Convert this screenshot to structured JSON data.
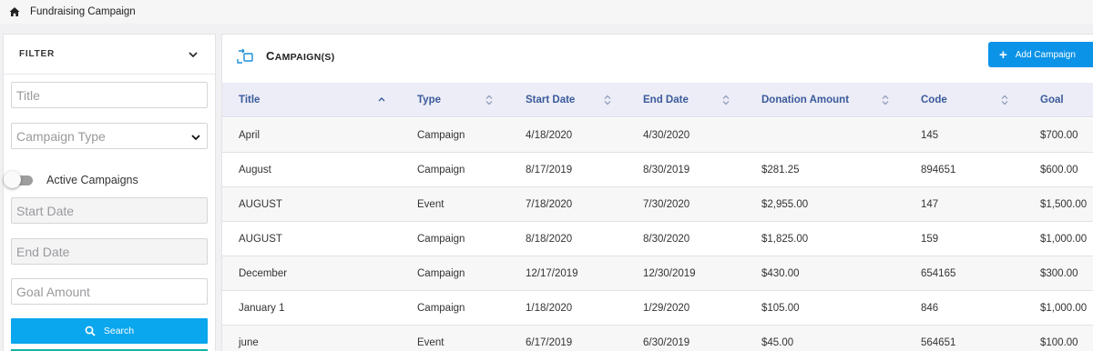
{
  "breadcrumb": {
    "page": "Fundraising Campaign"
  },
  "filter": {
    "header": "FILTER",
    "title_placeholder": "Title",
    "campaign_type_placeholder": "Campaign Type",
    "active_campaigns_label": "Active Campaigns",
    "active_campaigns_on": false,
    "start_date_placeholder": "Start Date",
    "end_date_placeholder": "End Date",
    "goal_amount_placeholder": "Goal Amount",
    "search_label": "Search"
  },
  "main": {
    "title_big": "C",
    "title_rest": "AMPAIGN(S)",
    "add_label": "Add Campaign"
  },
  "colors": {
    "accent": "#0b93e8",
    "search": "#0aa6ee",
    "header_text": "#3b5a9c"
  },
  "table": {
    "columns": [
      "Title",
      "Type",
      "Start Date",
      "End Date",
      "Donation Amount",
      "Code",
      "Goal"
    ],
    "rows": [
      [
        "April",
        "Campaign",
        "4/18/2020",
        "4/30/2020",
        "",
        "145",
        "$700.00"
      ],
      [
        "August",
        "Campaign",
        "8/17/2019",
        "8/30/2019",
        "$281.25",
        "894651",
        "$600.00"
      ],
      [
        "AUGUST",
        "Event",
        "7/18/2020",
        "7/30/2020",
        "$2,955.00",
        "147",
        "$1,500.00"
      ],
      [
        "AUGUST",
        "Campaign",
        "8/18/2020",
        "8/30/2020",
        "$1,825.00",
        "159",
        "$1,000.00"
      ],
      [
        "December",
        "Campaign",
        "12/17/2019",
        "12/30/2019",
        "$430.00",
        "654165",
        "$300.00"
      ],
      [
        "January 1",
        "Campaign",
        "1/18/2020",
        "1/29/2020",
        "$105.00",
        "846",
        "$1,000.00"
      ],
      [
        "june",
        "Event",
        "6/17/2019",
        "6/30/2019",
        "$45.00",
        "564651",
        "$100.00"
      ]
    ]
  }
}
